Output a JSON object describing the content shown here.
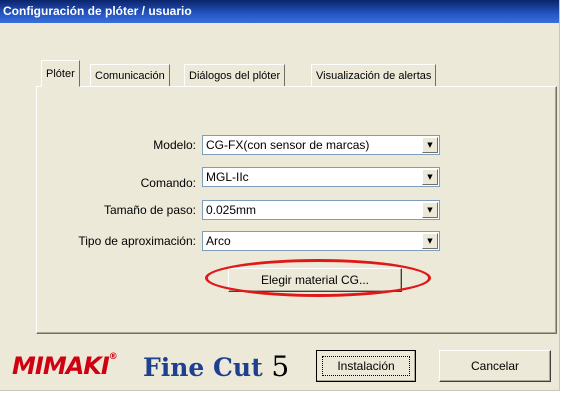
{
  "window": {
    "title": "Configuración de plóter / usuario"
  },
  "tabs": [
    {
      "label": "Plóter",
      "active": true
    },
    {
      "label": "Comunicación",
      "active": false
    },
    {
      "label": "Diálogos del plóter",
      "active": false
    },
    {
      "label": "Visualización de alertas",
      "active": false
    }
  ],
  "form": {
    "modelo": {
      "label": "Modelo:",
      "value": "CG-FX(con sensor de marcas)"
    },
    "comando": {
      "label": "Comando:",
      "value": "MGL-IIc"
    },
    "tamano_paso": {
      "label": "Tamaño de paso:",
      "value": "0.025mm"
    },
    "tipo_aprox": {
      "label": "Tipo de aproximación:",
      "value": "Arco"
    },
    "material_button": "Elegir material CG..."
  },
  "footer": {
    "brand_logo": "Mimaki",
    "product_name": "FineCut",
    "product_version": "5",
    "install_button": "Instalación",
    "cancel_button": "Cancelar"
  },
  "icons": {
    "dropdown": "chevron-down-icon"
  },
  "colors": {
    "dialog_bg": "#ece9d8",
    "titlebar": "#0a246a",
    "highlight_circle": "#e01818",
    "brand_red": "#d10011",
    "product_blue": "#1f3f8f"
  }
}
